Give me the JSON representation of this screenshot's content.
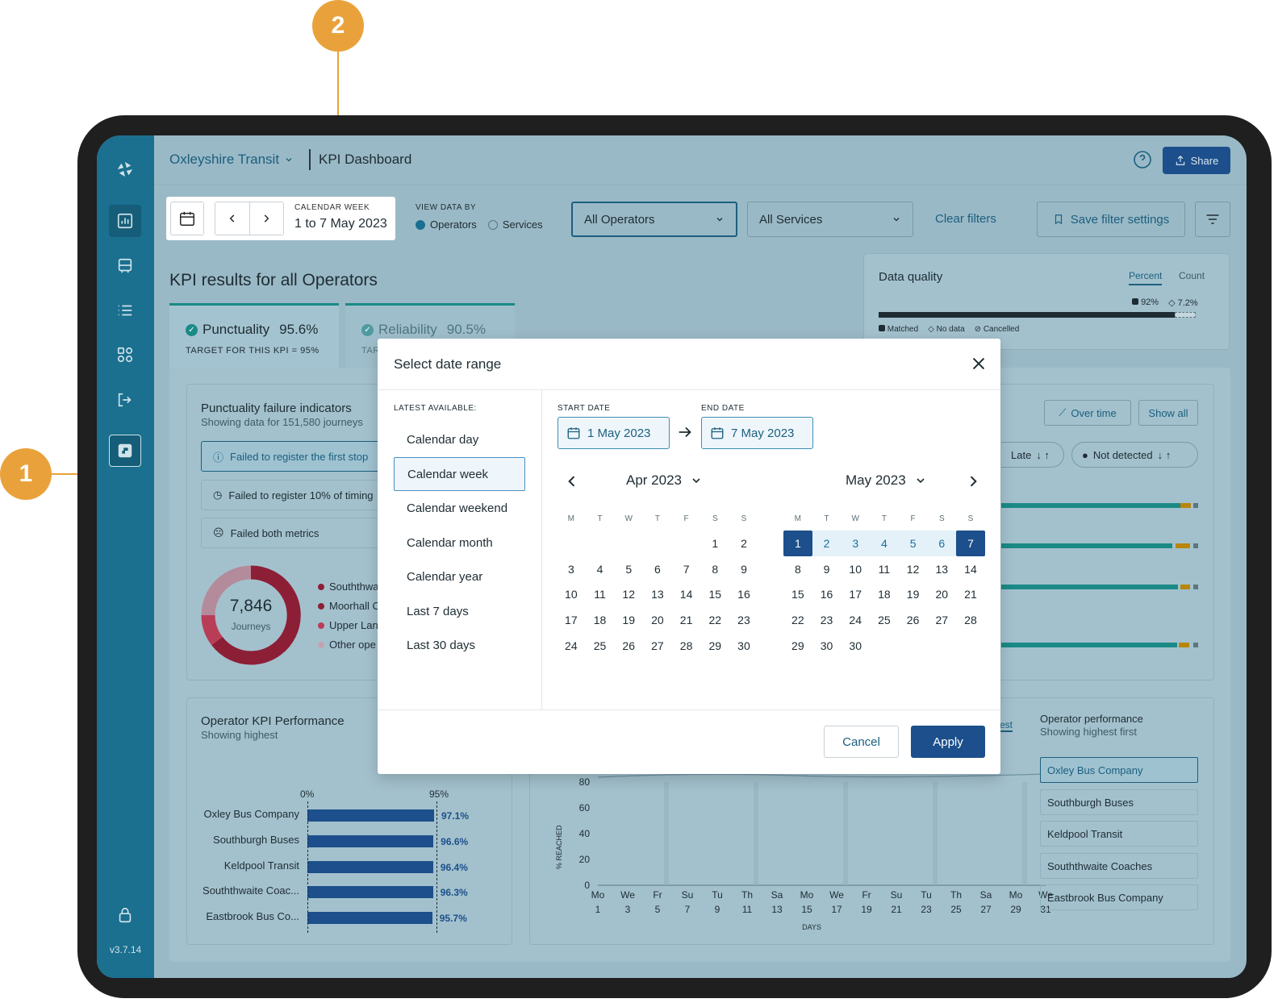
{
  "callouts": {
    "one": "1",
    "two": "2"
  },
  "header": {
    "org": "Oxleyshire Transit",
    "title": "KPI Dashboard",
    "share": "Share"
  },
  "sidebar": {
    "version": "v3.7.14"
  },
  "date_picker": {
    "label": "CALENDAR WEEK",
    "value": "1 to 7 May 2023"
  },
  "view_by": {
    "label": "VIEW DATA BY",
    "options": [
      "Operators",
      "Services"
    ],
    "selected": "Operators"
  },
  "filters": {
    "operators": "All Operators",
    "services": "All Services",
    "clear": "Clear filters",
    "save": "Save filter settings"
  },
  "kpi": {
    "heading": "KPI results for all Operators",
    "punctuality": {
      "name": "Punctuality",
      "value": "95.6%",
      "target": "TARGET FOR THIS KPI = 95%"
    },
    "reliability": {
      "name": "Reliability",
      "value": "90.5%",
      "target": "TAR"
    }
  },
  "data_quality": {
    "title": "Data quality",
    "tabs": [
      "Percent",
      "Count"
    ],
    "matched_pct": "92%",
    "nodata_pct": "7.2%",
    "legend": [
      "Matched",
      "No data",
      "Cancelled"
    ],
    "matched_fraction": 0.92,
    "nodata_fraction": 0.072
  },
  "failure": {
    "title": "Punctuality failure indicators",
    "subtitle": "Showing data for 151,580 journeys",
    "indicators": [
      "Failed to register the first stop",
      "Failed to register 10% of timing",
      "Failed both metrics"
    ],
    "donut_value": "7,846",
    "donut_label": "Journeys",
    "legend": [
      "Souththwa",
      "Moorhall C",
      "Upper Lan",
      "Other ope"
    ],
    "buttons": [
      "Over time",
      "Show all"
    ],
    "sort_pills": [
      "Late",
      "Not detected"
    ]
  },
  "operator_perf": {
    "title": "Operator KPI Performance",
    "subtitle": "Showing highest",
    "axis": [
      "0%",
      "95%"
    ],
    "bars": [
      {
        "label": "Oxley Bus Company",
        "value": 97.1,
        "text": "97.1%"
      },
      {
        "label": "Southburgh Buses",
        "value": 96.6,
        "text": "96.6%"
      },
      {
        "label": "Keldpool Transit",
        "value": 96.4,
        "text": "96.4%"
      },
      {
        "label": "Souththwaite Coac...",
        "value": 96.3,
        "text": "96.3%"
      },
      {
        "label": "Eastbrook Bus Co...",
        "value": 95.7,
        "text": "95.7%"
      }
    ]
  },
  "chart_data": {
    "type": "line",
    "title": "",
    "ylabel": "% REACHED",
    "xlabel": "DAYS",
    "ylim": [
      0,
      80
    ],
    "yticks": [
      0,
      20,
      40,
      60,
      80
    ],
    "x_days": [
      "Mo",
      "We",
      "Fr",
      "Su",
      "Tu",
      "Th",
      "Sa",
      "Mo",
      "We",
      "Fr",
      "Su",
      "Tu",
      "Th",
      "Sa",
      "Mo",
      "We"
    ],
    "x_dates": [
      "1",
      "3",
      "5",
      "7",
      "9",
      "11",
      "13",
      "15",
      "17",
      "19",
      "21",
      "23",
      "25",
      "27",
      "29",
      "31"
    ],
    "tab_fragment": "est"
  },
  "operator_list": {
    "title": "Operator performance",
    "subtitle": "Showing highest first",
    "items": [
      "Oxley Bus Company",
      "Southburgh Buses",
      "Keldpool Transit",
      "Souththwaite Coaches",
      "Eastbrook Bus Company"
    ]
  },
  "modal": {
    "title": "Select date range",
    "latest_label": "LATEST AVAILABLE:",
    "presets": [
      "Calendar day",
      "Calendar week",
      "Calendar weekend",
      "Calendar month",
      "Calendar year",
      "Last 7 days",
      "Last 30 days"
    ],
    "selected_preset": "Calendar week",
    "start_label": "START DATE",
    "start_value": "1 May 2023",
    "end_label": "END DATE",
    "end_value": "7 May 2023",
    "left_month": "Apr 2023",
    "right_month": "May 2023",
    "weekdays": [
      "M",
      "T",
      "W",
      "T",
      "F",
      "S",
      "S"
    ],
    "apr_offset": 5,
    "apr_days": 30,
    "may_offset": 0,
    "may_days": 31,
    "may_extra": "30",
    "range_start": 1,
    "range_end": 7,
    "cancel": "Cancel",
    "apply": "Apply"
  }
}
